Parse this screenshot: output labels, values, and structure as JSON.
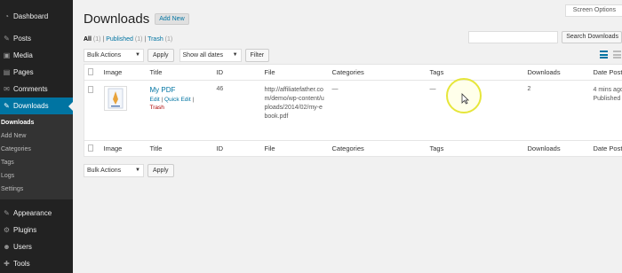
{
  "sidebar": {
    "items_top": [
      {
        "label": "Dashboard",
        "icon": "dashboard-icon",
        "glyph": "◔"
      },
      {
        "label": "Posts",
        "icon": "pin-icon",
        "glyph": "✎"
      },
      {
        "label": "Media",
        "icon": "media-icon",
        "glyph": "▣"
      },
      {
        "label": "Pages",
        "icon": "pages-icon",
        "glyph": "▤"
      },
      {
        "label": "Comments",
        "icon": "comments-icon",
        "glyph": "✉"
      },
      {
        "label": "Downloads",
        "icon": "download-icon",
        "glyph": "✎"
      }
    ],
    "submenu": [
      "Downloads",
      "Add New",
      "Categories",
      "Tags",
      "Logs",
      "Settings"
    ],
    "items_bottom": [
      {
        "label": "Appearance",
        "icon": "appearance-icon",
        "glyph": "✎"
      },
      {
        "label": "Plugins",
        "icon": "plugins-icon",
        "glyph": "⚙"
      },
      {
        "label": "Users",
        "icon": "users-icon",
        "glyph": "☻"
      },
      {
        "label": "Tools",
        "icon": "tools-icon",
        "glyph": "✚"
      }
    ]
  },
  "header": {
    "title": "Downloads",
    "add_new": "Add New",
    "screen_options": "Screen Options"
  },
  "filters": {
    "all": "All",
    "all_count": "(1)",
    "published": "Published",
    "published_count": "(1)",
    "trash": "Trash",
    "trash_count": "(1)",
    "separator": "|"
  },
  "search": {
    "placeholder": "",
    "button": "Search Downloads"
  },
  "tablenav_top": {
    "bulk_actions": "Bulk Actions",
    "apply": "Apply",
    "dates": "Show all dates",
    "filter": "Filter"
  },
  "tablenav_bottom": {
    "bulk_actions": "Bulk Actions",
    "apply": "Apply"
  },
  "columns": [
    "Image",
    "Title",
    "ID",
    "File",
    "Categories",
    "Tags",
    "Downloads",
    "Date Posted"
  ],
  "rows": [
    {
      "title": "My PDF",
      "actions": {
        "edit": "Edit",
        "quick_edit": "Quick Edit",
        "trash": "Trash",
        "sep": "|"
      },
      "id": "46",
      "file": "http://affiliatefather.com/demo/wp-content/uploads/2014/02/my-ebook.pdf",
      "categories": "—",
      "tags": "—",
      "downloads": "2",
      "date": "4 mins ago",
      "status": "Published"
    }
  ],
  "colors": {
    "sidebar_bg": "#222222",
    "accent": "#0074a2",
    "trash": "#aa0000",
    "highlight": "#e6e63a"
  }
}
